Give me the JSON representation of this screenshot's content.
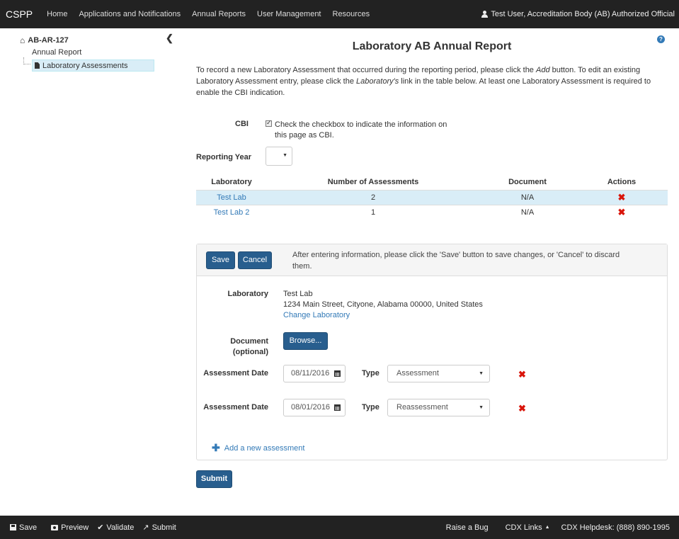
{
  "nav": {
    "brand": "CSPP",
    "links": [
      "Home",
      "Applications and Notifications",
      "Annual Reports",
      "User Management",
      "Resources"
    ],
    "user": "Test User, Accreditation Body (AB) Authorized Official"
  },
  "sidebar": {
    "root": "AB-AR-127",
    "child": "Annual Report",
    "selected": "Laboratory Assessments"
  },
  "main": {
    "title": "Laboratory AB Annual Report",
    "intro_part1": "To record a new Laboratory Assessment that occurred during the reporting period, please click the ",
    "intro_add": "Add",
    "intro_part2": " button. To edit an existing Laboratory Assessment entry, please click the ",
    "intro_lab": "Laboratory's",
    "intro_part3": " link in the table below. At least one Laboratory Assessment is required to enable the CBI indication.",
    "cbi_label": "CBI",
    "cbi_checked": true,
    "cbi_text": "Check the checkbox to indicate the information on this page as CBI.",
    "reporting_year_label": "Reporting Year",
    "reporting_year_value": ""
  },
  "table": {
    "headers": [
      "Laboratory",
      "Number of Assessments",
      "Document",
      "Actions"
    ],
    "rows": [
      {
        "laboratory": "Test Lab",
        "count": "2",
        "document": "N/A",
        "highlighted": true
      },
      {
        "laboratory": "Test Lab 2",
        "count": "1",
        "document": "N/A",
        "highlighted": false
      }
    ]
  },
  "panel": {
    "save_label": "Save",
    "cancel_label": "Cancel",
    "message": "After entering information, please click the 'Save' button to save changes, or 'Cancel' to discard them.",
    "laboratory_label": "Laboratory",
    "lab_name": "Test Lab",
    "lab_address": "1234 Main Street, Cityone, Alabama 00000, United States",
    "change_lab": "Change Laboratory",
    "document_label": "Document (optional)",
    "browse_label": "Browse...",
    "assessment_date_label": "Assessment Date",
    "type_label": "Type",
    "assessments": [
      {
        "date": "08/11/2016",
        "type": "Assessment"
      },
      {
        "date": "08/01/2016",
        "type": "Reassessment"
      }
    ],
    "add_assessment": "Add a new assessment"
  },
  "submit_label": "Submit",
  "footer": {
    "save": "Save",
    "preview": "Preview",
    "validate": "Validate",
    "submit": "Submit",
    "raise_bug": "Raise a Bug",
    "cdx_links": "CDX Links",
    "helpdesk": "CDX Helpdesk: (888) 890-1995"
  },
  "colors": {
    "link": "#337ab7",
    "primary_button": "#285e8e",
    "highlight_row": "#d9edf7",
    "delete": "#d9150a",
    "navbar": "#222222"
  }
}
